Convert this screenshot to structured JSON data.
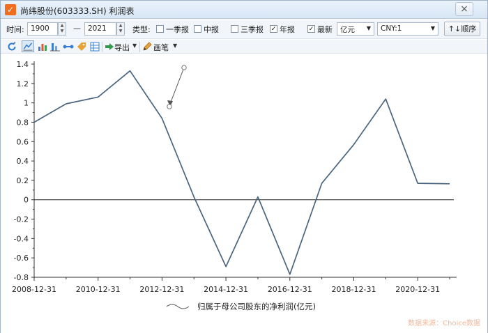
{
  "window": {
    "title": "尚纬股份(603333.SH) 利润表",
    "app_icon": "checkmark-icon",
    "close_icon": "close-icon"
  },
  "toolbar": {
    "time_label": "时间:",
    "start_year": "1900",
    "dash": "—",
    "end_year": "2021",
    "type_label": "类型:",
    "checkboxes": [
      {
        "label": "一季报",
        "checked": false
      },
      {
        "label": "中报",
        "checked": false
      },
      {
        "label": "三季报",
        "checked": false
      },
      {
        "label": "年报",
        "checked": true
      },
      {
        "label": "最新",
        "checked": true
      }
    ],
    "unit_select": "亿元",
    "currency_select": "CNY:1",
    "order_button": "↑↓顺序"
  },
  "toolbar2": {
    "export_label": "导出",
    "brush_label": "画笔",
    "icons": [
      "refresh-icon",
      "line-chart-icon",
      "bar-chart-icon",
      "stacked-bar-icon",
      "compare-icon",
      "tag-icon",
      "table-icon",
      "export-icon",
      "pencil-icon"
    ]
  },
  "chart_data": {
    "type": "line",
    "x": [
      "2008-12-31",
      "2009-12-31",
      "2010-12-31",
      "2011-12-31",
      "2012-12-31",
      "2013-12-31",
      "2014-12-31",
      "2015-12-31",
      "2016-12-31",
      "2017-12-31",
      "2018-12-31",
      "2019-12-31",
      "2020-12-31",
      "2021-12-31"
    ],
    "x_tick_labels": [
      "2008-12-31",
      "2010-12-31",
      "2012-12-31",
      "2014-12-31",
      "2016-12-31",
      "2018-12-31",
      "2020-12-31"
    ],
    "series": [
      {
        "name": "归属于母公司股东的净利润(亿元)",
        "color": "#4a6580",
        "values": [
          0.8,
          0.99,
          1.06,
          1.33,
          0.84,
          0.03,
          -0.69,
          0.03,
          -0.77,
          0.17,
          0.57,
          1.04,
          0.17,
          0.165
        ]
      }
    ],
    "ylim": [
      -0.8,
      1.4
    ],
    "y_ticks": [
      "-0.8",
      "-0.6",
      "-0.4",
      "-0.2",
      "0",
      "0.2",
      "0.4",
      "0.6",
      "0.8",
      "1",
      "1.2",
      "1.4"
    ],
    "legend_position": "bottom-center"
  },
  "watermark": "数据来源：Choice数据"
}
